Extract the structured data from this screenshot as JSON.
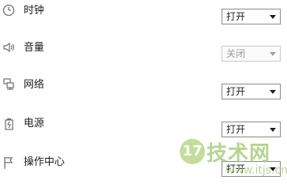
{
  "settings": [
    {
      "label": "时钟",
      "value": "打开",
      "icon": "clock-icon",
      "enabled": true
    },
    {
      "label": "音量",
      "value": "关闭",
      "icon": "speaker-icon",
      "enabled": false
    },
    {
      "label": "网络",
      "value": "打开",
      "icon": "network-icon",
      "enabled": true
    },
    {
      "label": "电源",
      "value": "打开",
      "icon": "power-icon",
      "enabled": true
    },
    {
      "label": "操作中心",
      "value": "打开",
      "icon": "flag-icon",
      "enabled": true
    }
  ],
  "watermark": {
    "badge": "17",
    "text": "技术网",
    "url": "www.itjs.cn"
  }
}
